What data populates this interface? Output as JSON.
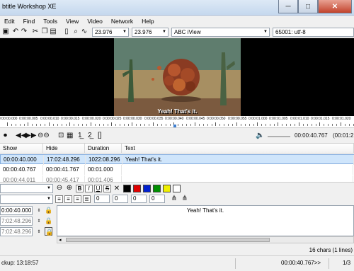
{
  "window": {
    "title": "btitle Workshop XE"
  },
  "menu": [
    "Edit",
    "Find",
    "Tools",
    "View",
    "Video",
    "Network",
    "Help"
  ],
  "toolbar": {
    "fps_in": "23.976",
    "fps_out": "23.976",
    "format": "ABC iView",
    "encoding": "65001: utf-8"
  },
  "video": {
    "subtitle_overlay": "Yeah! That's it."
  },
  "timeline": {
    "ticks": [
      "0:00:00.000",
      "0:00:00.005",
      "0:00:00.010",
      "0:00:00.015",
      "0:00:00.020",
      "0:00:00.025",
      "0:00:00.030",
      "0:00:00.035",
      "0:00:00.040",
      "0:00:00.045",
      "0:00:00.050",
      "0:00:00.055",
      "0:00:01.000",
      "0:00:01.005",
      "0:00:01.010",
      "0:00:01.015",
      "0:00:01.020"
    ],
    "position_fraction": 0.49
  },
  "controls": {
    "position": "00:00:40.767",
    "next_time": "(00:01:2"
  },
  "grid": {
    "columns": [
      "Show",
      "Hide",
      "Duration",
      "Text"
    ],
    "rows": [
      {
        "show": "00:00:40.000",
        "hide": "17:02:48.296",
        "duration": "1022:08.296",
        "text": "Yeah! That's it."
      },
      {
        "show": "00:00:40.767",
        "hide": "00:00:41.767",
        "duration": "00:01.000",
        "text": ""
      },
      {
        "show": "00:00:44.011",
        "hide": "00:00:45.417",
        "duration": "00:01.406",
        "text": ""
      }
    ]
  },
  "editor": {
    "format_buttons": [
      "B",
      "I",
      "U",
      "S"
    ],
    "colors": [
      "#000000",
      "#e00000",
      "#0020d0",
      "#009000",
      "#f0f000",
      "#ffffff"
    ],
    "numbers": [
      "0",
      "0",
      "0",
      "0"
    ],
    "show_time": "0:00:40.000",
    "hide_time": "7:02:48.296",
    "duration_time": "7:02:48.296",
    "text": "Yeah! That's it.",
    "char_count": "16 chars (1 lines)"
  },
  "status": {
    "backup": "ckup: 13:18:57",
    "position": "00:00:40.767>>",
    "page": "1/3"
  }
}
